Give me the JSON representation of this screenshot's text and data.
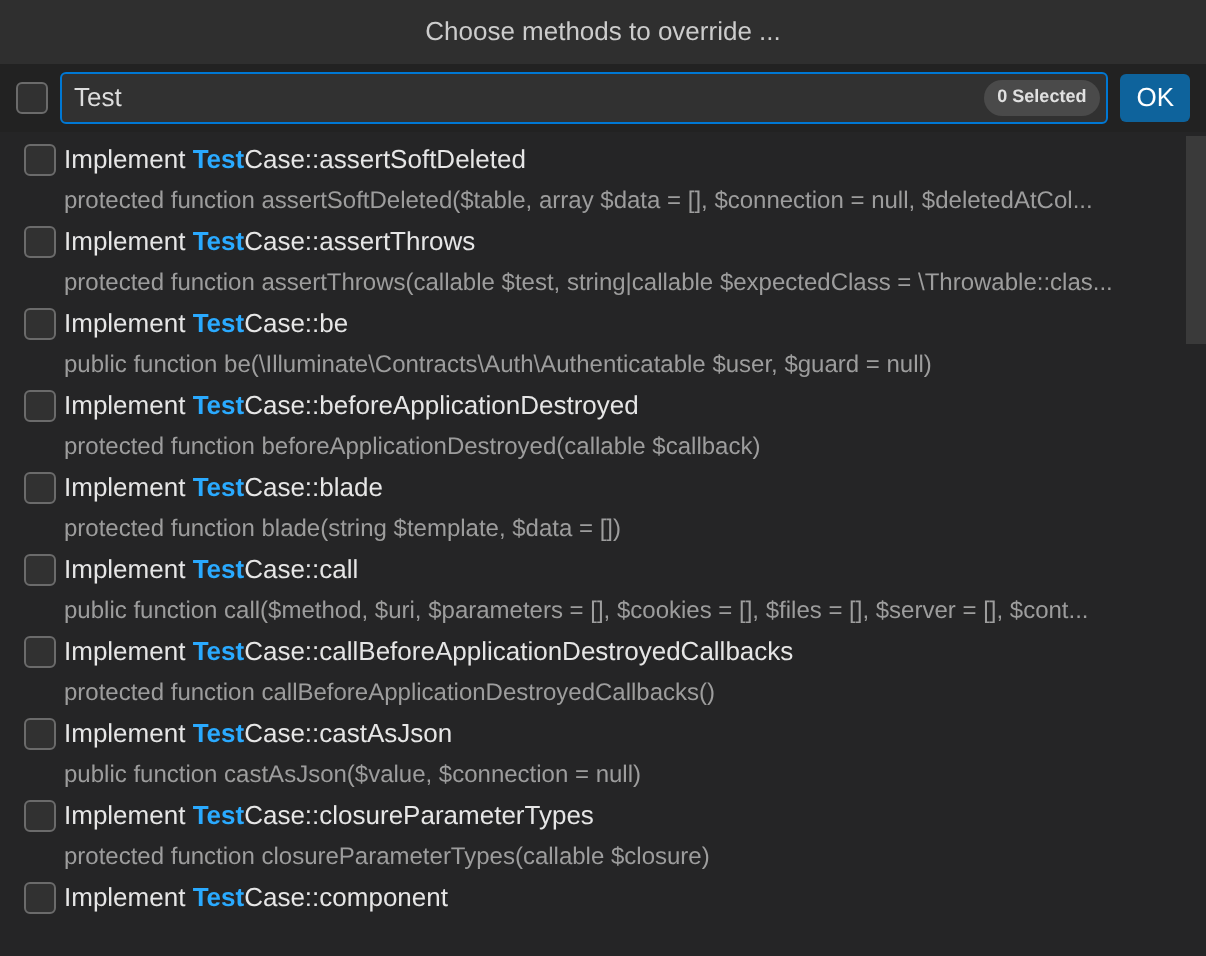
{
  "title": "Choose methods to override ...",
  "select_all": {
    "checked": false
  },
  "search": {
    "value": "Test",
    "selected_count": "0 Selected"
  },
  "ok_button": "OK",
  "items": [
    {
      "prefix": "Implement ",
      "match": "Test",
      "rest": "Case::assertSoftDeleted",
      "detail": "protected function assertSoftDeleted($table, array $data = [], $connection = null, $deletedAtCol...",
      "checked": false
    },
    {
      "prefix": "Implement ",
      "match": "Test",
      "rest": "Case::assertThrows",
      "detail": "protected function assertThrows(callable $test, string|callable $expectedClass = \\Throwable::clas...",
      "checked": false
    },
    {
      "prefix": "Implement ",
      "match": "Test",
      "rest": "Case::be",
      "detail": "public function be(\\Illuminate\\Contracts\\Auth\\Authenticatable $user, $guard = null)",
      "checked": false
    },
    {
      "prefix": "Implement ",
      "match": "Test",
      "rest": "Case::beforeApplicationDestroyed",
      "detail": "protected function beforeApplicationDestroyed(callable $callback)",
      "checked": false
    },
    {
      "prefix": "Implement ",
      "match": "Test",
      "rest": "Case::blade",
      "detail": "protected function blade(string $template, $data = [])",
      "checked": false
    },
    {
      "prefix": "Implement ",
      "match": "Test",
      "rest": "Case::call",
      "detail": "public function call($method, $uri, $parameters = [], $cookies = [], $files = [], $server = [], $cont...",
      "checked": false
    },
    {
      "prefix": "Implement ",
      "match": "Test",
      "rest": "Case::callBeforeApplicationDestroyedCallbacks",
      "detail": "protected function callBeforeApplicationDestroyedCallbacks()",
      "checked": false
    },
    {
      "prefix": "Implement ",
      "match": "Test",
      "rest": "Case::castAsJson",
      "detail": "public function castAsJson($value, $connection = null)",
      "checked": false
    },
    {
      "prefix": "Implement ",
      "match": "Test",
      "rest": "Case::closureParameterTypes",
      "detail": "protected function closureParameterTypes(callable $closure)",
      "checked": false
    },
    {
      "prefix": "Implement ",
      "match": "Test",
      "rest": "Case::component",
      "checked": false
    }
  ]
}
